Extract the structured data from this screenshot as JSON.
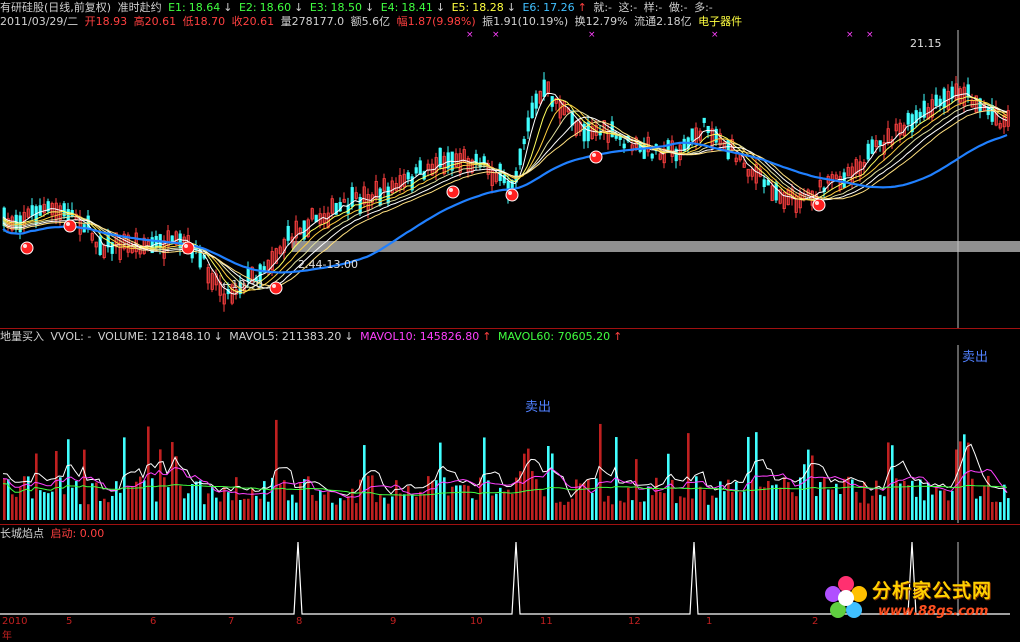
{
  "header": {
    "stock_name": "有研硅股(日线,前复权)",
    "mode": "准时赴约",
    "e_values": [
      {
        "label": "E1:",
        "value": "18.64",
        "arrow": "↓"
      },
      {
        "label": "E2:",
        "value": "18.60",
        "arrow": "↓"
      },
      {
        "label": "E3:",
        "value": "18.50",
        "arrow": "↓"
      },
      {
        "label": "E4:",
        "value": "18.41",
        "arrow": "↓"
      },
      {
        "label": "E5:",
        "value": "18.28",
        "arrow": "↓"
      },
      {
        "label": "E6:",
        "value": "17.26",
        "arrow": "↑"
      }
    ],
    "tags": [
      "就:-",
      "这:-",
      "样:-",
      "做:-",
      "多:-"
    ],
    "date": "2011/03/29/二",
    "open": "开18.93",
    "high": "高20.61",
    "low": "低18.70",
    "close": "收20.61",
    "volume": "量278177.0",
    "amount": "额5.6亿",
    "change": "幅1.87(9.98%)",
    "amplitude": "振1.91(10.19%)",
    "turnover": "换12.79%",
    "float": "流通2.18亿",
    "sector": "电子器件"
  },
  "price_panel": {
    "high_label": "21.15",
    "low_label": "←10.30",
    "range_label": "2.44-13.00"
  },
  "volume_panel": {
    "title": "地量买入",
    "vvol": "VVOL: -",
    "volume": "VOLUME: 121848.10",
    "volume_arrow": "↓",
    "mavol5": "MAVOL5: 211383.20",
    "mavol5_arrow": "↓",
    "mavol10": "MAVOL10: 145826.80",
    "mavol10_arrow": "↑",
    "mavol60": "MAVOL60: 70605.20",
    "mavol60_arrow": "↑",
    "sell_label_1": "卖出",
    "sell_label_2": "卖出"
  },
  "signal_panel": {
    "title": "长城焰点",
    "start": "启动: 0.00"
  },
  "x_axis": [
    "2010年",
    "5",
    "6",
    "7",
    "8",
    "9",
    "10",
    "11",
    "12",
    "1",
    "2"
  ],
  "logo": {
    "text": "分析家公式网",
    "url": "www.88gs.com"
  },
  "colors": {
    "up": "#ff4040",
    "down": "#40ffff",
    "ma_long": "#2080ff",
    "highlight": "#40ff40",
    "separator": "#a01010"
  }
}
